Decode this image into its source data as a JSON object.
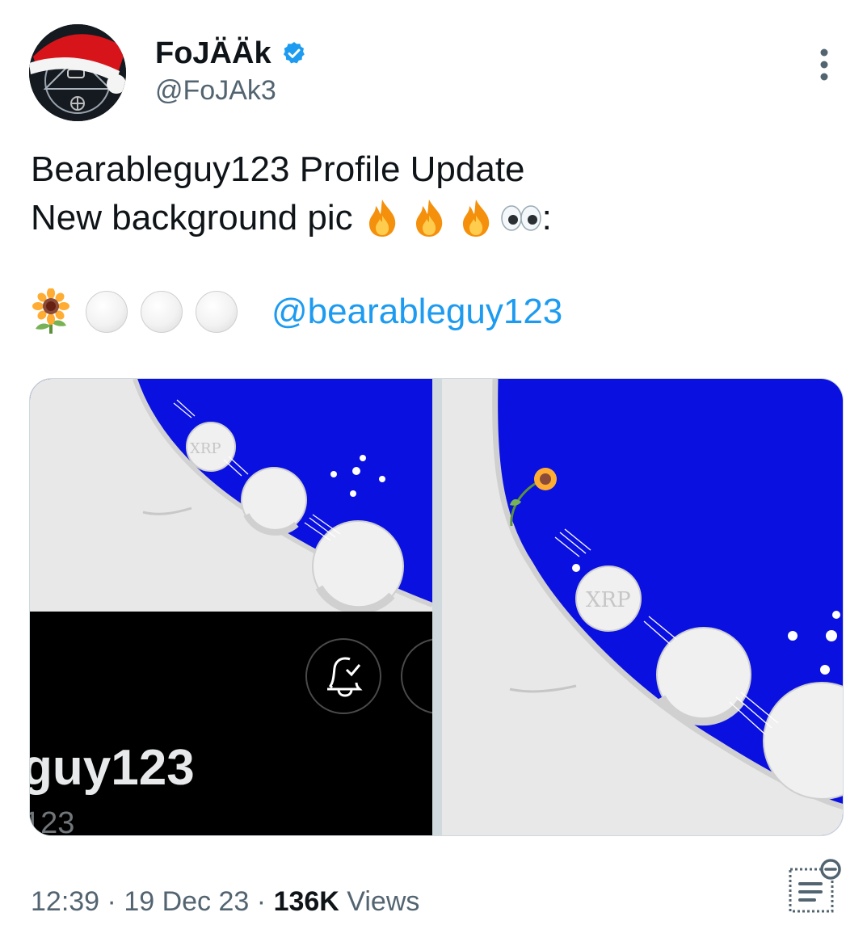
{
  "author": {
    "display_name": "FoJÄÄk",
    "handle": "@FoJAk3",
    "verified": true,
    "avatar": "santa-hat-avatar"
  },
  "tweet": {
    "line1": "Bearableguy123  Profile Update",
    "line2_text": "New background pic",
    "line2_suffix": ":",
    "mention": "@bearableguy123"
  },
  "media": {
    "left_image": {
      "username_fragment": "guy123",
      "handle_fragment": "123",
      "coin_label": "XRP"
    },
    "right_image": {
      "coin_label": "XRP"
    }
  },
  "footer": {
    "time": "12:39",
    "separator": "·",
    "date": "19 Dec 23",
    "views_count": "136K",
    "views_label": "Views"
  },
  "colors": {
    "link": "#1d9bf0",
    "verified": "#1d9bf0",
    "muted": "#536471",
    "image_blue": "#0a10e0"
  },
  "icons": [
    "verified-badge-icon",
    "more-options-icon",
    "fire-emoji",
    "eyes-emoji",
    "sunflower-emoji",
    "white-circle-emoji",
    "notification-bell-icon",
    "reader-mode-icon"
  ]
}
